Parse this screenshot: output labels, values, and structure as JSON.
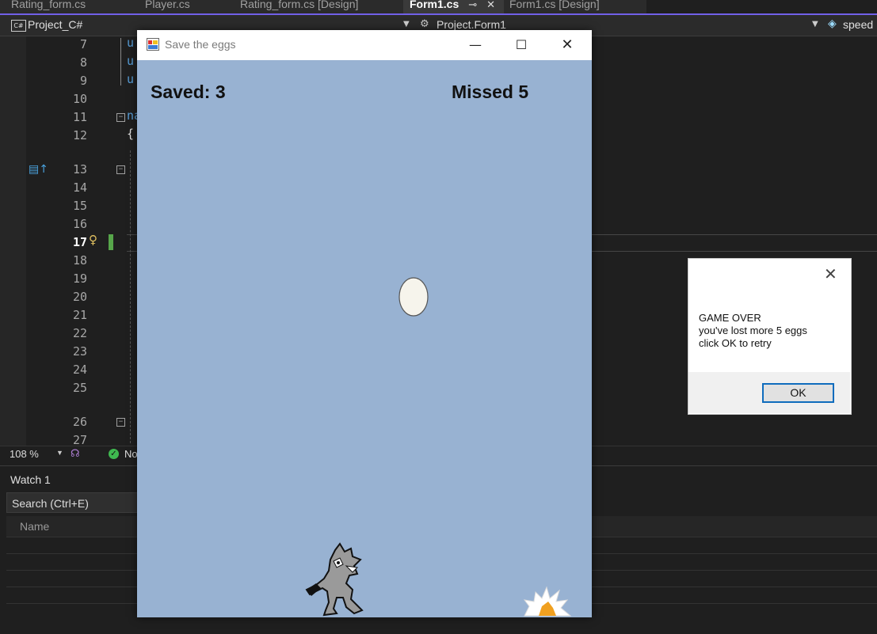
{
  "tabs": [
    {
      "label": "Rating_form.cs"
    },
    {
      "label": "Player.cs"
    },
    {
      "label": "Rating_form.cs [Design]"
    },
    {
      "label": "Form1.cs"
    },
    {
      "label": "Form1.cs [Design]"
    }
  ],
  "tab_pin_glyph": "⊸",
  "tab_close_glyph": "✕",
  "navbar": {
    "project": "Project_C#",
    "project_badge": "C#",
    "class": "Project.Form1",
    "member": "speed"
  },
  "editor": {
    "line_numbers": [
      "7",
      "8",
      "9",
      "10",
      "11",
      "12",
      "13",
      "14",
      "15",
      "16",
      "17",
      "18",
      "19",
      "20",
      "21",
      "22",
      "23",
      "24",
      "25",
      "26",
      "27"
    ],
    "current_line": "17",
    "code_fragments": [
      "u",
      "u",
      "u",
      "na",
      "{"
    ]
  },
  "status": {
    "zoom": "108 %",
    "issues": "No"
  },
  "watch": {
    "title": "Watch 1",
    "search_placeholder": "Search (Ctrl+E)",
    "column_name": "Name"
  },
  "game": {
    "window_title": "Save the eggs",
    "saved_label": "Saved: 3",
    "missed_label": "Missed 5",
    "saved_count": 3,
    "missed_count": 5,
    "background_color": "#98b2d2"
  },
  "dialog": {
    "message": "GAME OVER\nyou've lost more 5 eggs\nclick OK to retry",
    "ok_label": "OK"
  }
}
